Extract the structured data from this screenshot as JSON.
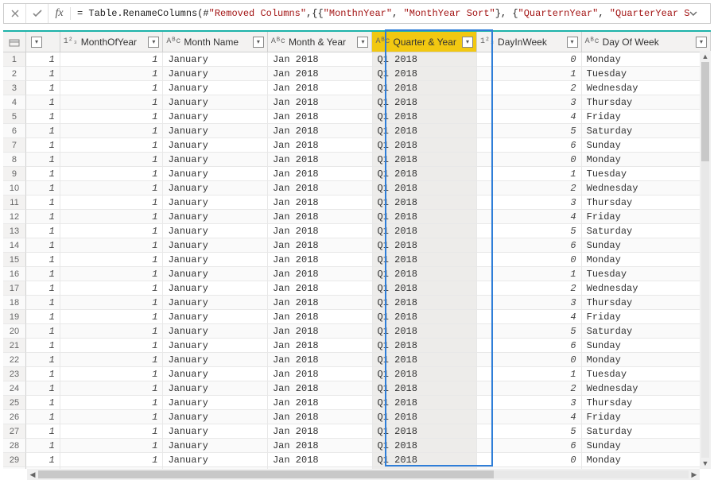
{
  "formula": {
    "prefix": "= Table.RenameColumns(#",
    "s1": "\"Removed Columns\"",
    "mid1": ",{{",
    "s2": "\"MonthnYear\"",
    "mid2": ", ",
    "s3": "\"MonthYear Sort\"",
    "mid3": "}, {",
    "s4": "\"QuarternYear\"",
    "mid4": ", ",
    "s5": "\"QuarterYear Sort\"",
    "suffix": "}})"
  },
  "columns": [
    {
      "icon": "",
      "name": "",
      "small": true
    },
    {
      "icon": "1²₃",
      "name": "MonthOfYear"
    },
    {
      "icon": "Aᴮc",
      "name": "Month Name"
    },
    {
      "icon": "Aᴮc",
      "name": "Month & Year"
    },
    {
      "icon": "Aᴮc",
      "name": "Quarter & Year",
      "selected": true
    },
    {
      "icon": "1²₃",
      "name": "DayInWeek"
    },
    {
      "icon": "Aᴮc",
      "name": "Day Of Week"
    }
  ],
  "days": [
    "Monday",
    "Tuesday",
    "Wednesday",
    "Thursday",
    "Friday",
    "Saturday",
    "Sunday"
  ],
  "monthOfYear": "1",
  "monthName": "January",
  "monthYear": "Jan 2018",
  "quarterYear": "Q1 2018",
  "colA": "1",
  "rowCount": 30
}
